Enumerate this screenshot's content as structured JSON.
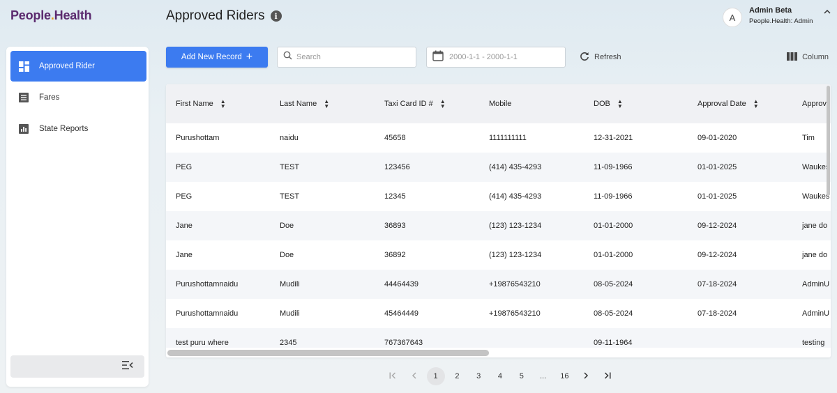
{
  "brand": {
    "part1": "People",
    "dot": ".",
    "part2": "Health"
  },
  "header": {
    "title": "Approved Riders",
    "info_icon": "info-icon"
  },
  "user": {
    "initial": "A",
    "name": "Admin Beta",
    "role": "People.Health: Admin",
    "caret": "chevron-up-icon"
  },
  "sidebar": {
    "items": [
      {
        "label": "Approved Rider",
        "icon": "dashboard-icon",
        "active": true
      },
      {
        "label": "Fares",
        "icon": "list-icon",
        "active": false
      },
      {
        "label": "State Reports",
        "icon": "bar-chart-icon",
        "active": false
      }
    ],
    "collapse_icon": "collapse-menu-icon"
  },
  "toolbar": {
    "add_label": "Add New Record",
    "add_icon": "+",
    "search_placeholder": "Search",
    "date_placeholder": "2000-1-1 - 2000-1-1",
    "refresh_label": "Refresh",
    "column_label": "Column"
  },
  "table": {
    "headers": [
      "First Name",
      "Last Name",
      "Taxi Card ID #",
      "Mobile",
      "DOB",
      "Approval Date",
      "Approv"
    ],
    "sortable": [
      true,
      true,
      true,
      false,
      true,
      true,
      false
    ],
    "rows": [
      [
        "Purushottam",
        "naidu",
        "45658",
        "1111111111",
        "12-31-2021",
        "09-01-2020",
        "Tim"
      ],
      [
        "PEG",
        "TEST",
        "123456",
        "(414) 435-4293",
        "11-09-1966",
        "01-01-2025",
        "Waukes"
      ],
      [
        "PEG",
        "TEST",
        "12345",
        "(414) 435-4293",
        "11-09-1966",
        "01-01-2025",
        "Waukes"
      ],
      [
        "Jane",
        "Doe",
        "36893",
        "(123) 123-1234",
        "01-01-2000",
        "09-12-2024",
        "jane do"
      ],
      [
        "Jane",
        "Doe",
        "36892",
        "(123) 123-1234",
        "01-01-2000",
        "09-12-2024",
        "jane do"
      ],
      [
        "Purushottamnaidu",
        "Mudili",
        "44464439",
        "+19876543210",
        "08-05-2024",
        "07-18-2024",
        "AdminU"
      ],
      [
        "Purushottamnaidu",
        "Mudili",
        "45464449",
        "+19876543210",
        "08-05-2024",
        "07-18-2024",
        "AdminU"
      ],
      [
        "test puru where",
        "2345",
        "767367643",
        "",
        "09-11-1964",
        "",
        "testing"
      ]
    ]
  },
  "pagination": {
    "first": "first-page-icon",
    "prev": "prev-page-icon",
    "pages": [
      "1",
      "2",
      "3",
      "4",
      "5",
      "...",
      "16"
    ],
    "current": "1",
    "next": "next-page-icon",
    "last": "last-page-icon"
  },
  "colors": {
    "accent": "#3c7bf0",
    "brand": "#5b2a6e",
    "brand_dot": "#e0a020"
  }
}
